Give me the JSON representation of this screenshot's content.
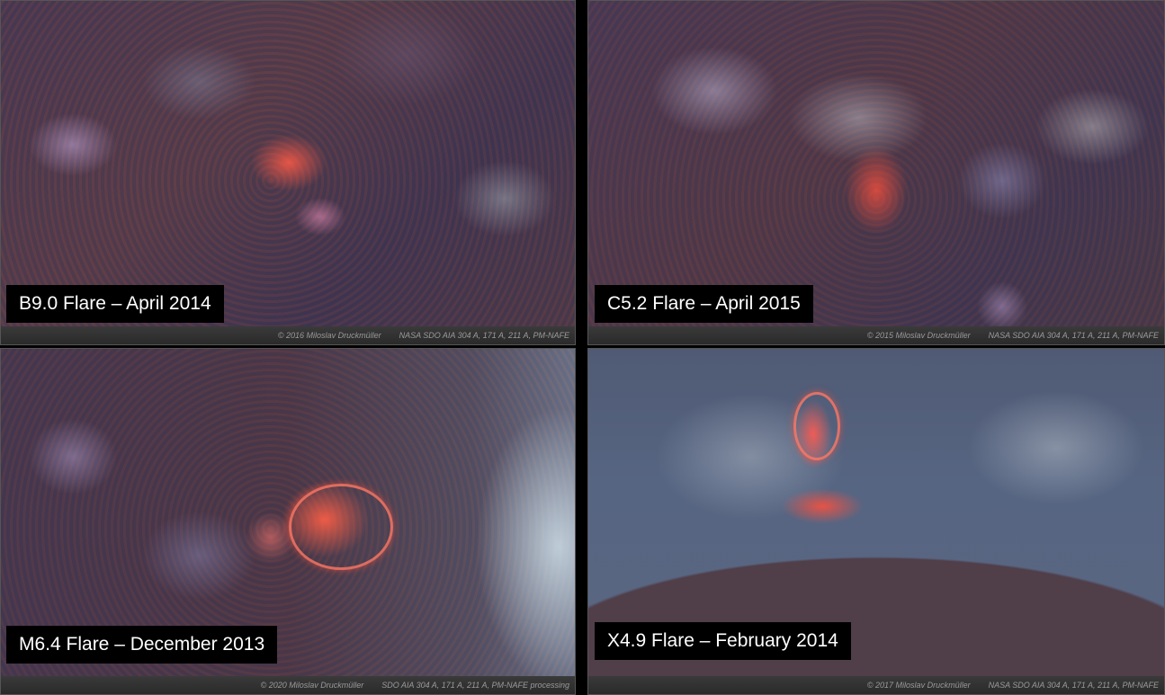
{
  "panels": [
    {
      "caption": "B9.0 Flare – April 2014",
      "credit_left": "© 2016 Miloslav Druckmüller",
      "credit_right": "NASA SDO AIA 304 A, 171 A, 211 A, PM-NAFE"
    },
    {
      "caption": "C5.2 Flare – April 2015",
      "credit_left": "© 2015 Miloslav Druckmüller",
      "credit_right": "NASA SDO AIA 304 A, 171 A, 211 A, PM-NAFE"
    },
    {
      "caption": "M6.4 Flare – December 2013",
      "credit_left": "© 2020 Miloslav Druckmüller",
      "credit_right": "SDO AIA 304 A, 171 A, 211 A, PM-NAFE processing"
    },
    {
      "caption": "X4.9 Flare – February 2014",
      "credit_left": "© 2017 Miloslav Druckmüller",
      "credit_right": "NASA SDO AIA 304 A, 171 A, 211 A, PM-NAFE"
    }
  ]
}
